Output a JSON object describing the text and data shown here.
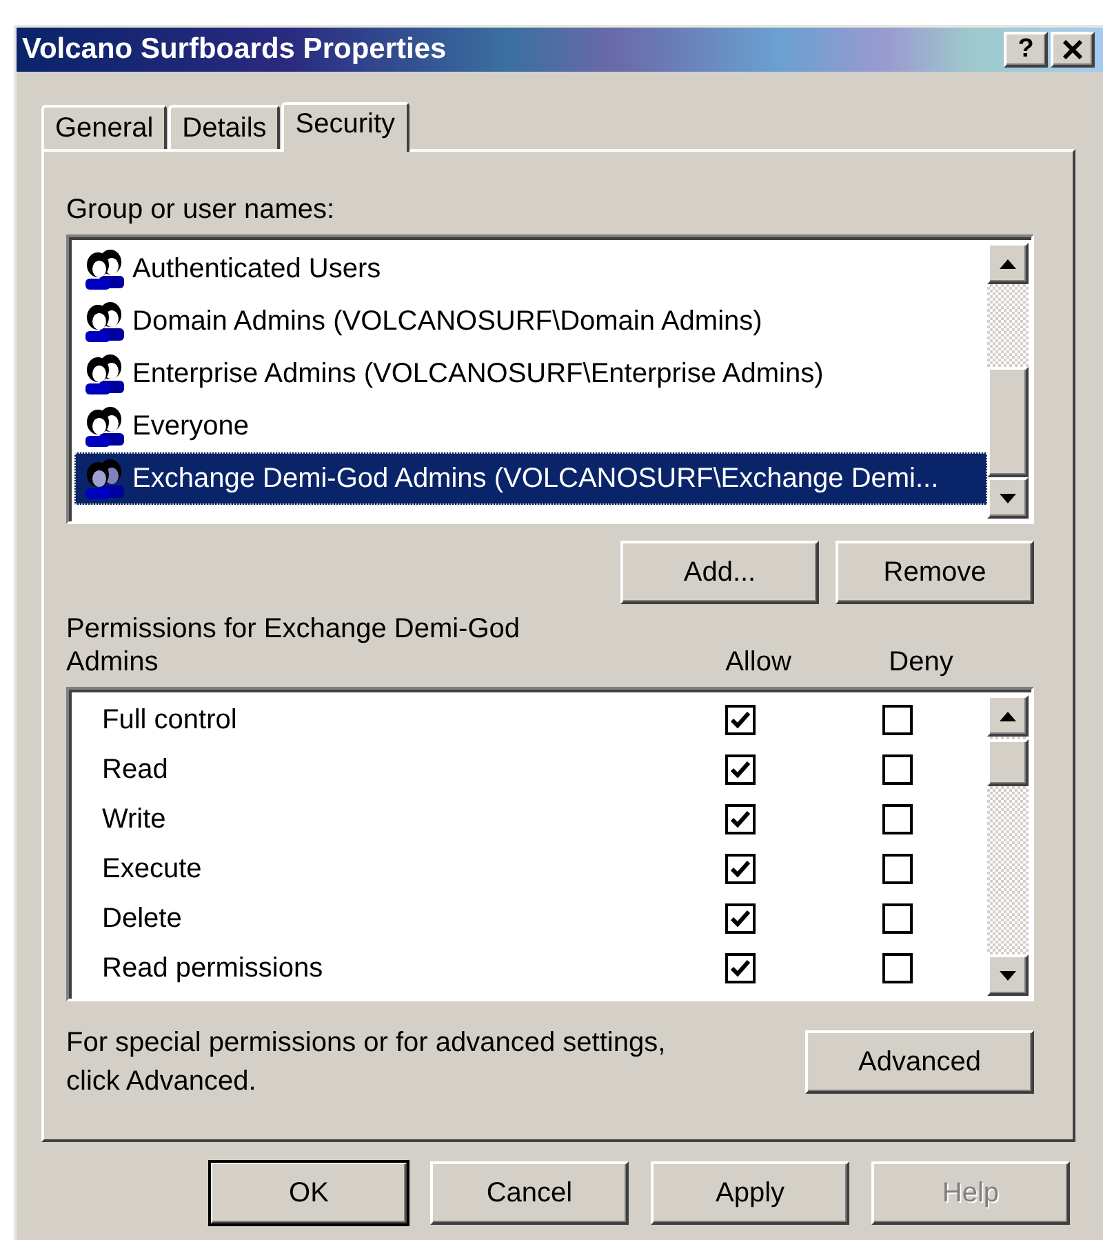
{
  "window": {
    "title": "Volcano Surfboards Properties",
    "help_button": "?"
  },
  "tabs": [
    {
      "label": "General",
      "selected": false
    },
    {
      "label": "Details",
      "selected": false
    },
    {
      "label": "Security",
      "selected": true
    }
  ],
  "groups": {
    "label": "Group or user names:",
    "items": [
      {
        "name": "Authenticated Users",
        "selected": false
      },
      {
        "name": "Domain Admins (VOLCANOSURF\\Domain Admins)",
        "selected": false
      },
      {
        "name": "Enterprise Admins (VOLCANOSURF\\Enterprise Admins)",
        "selected": false
      },
      {
        "name": "Everyone",
        "selected": false
      },
      {
        "name": "Exchange Demi-God Admins (VOLCANOSURF\\Exchange Demi...",
        "selected": true
      }
    ],
    "buttons": [
      "Add...",
      "Remove"
    ]
  },
  "permissions": {
    "label": "Permissions for Exchange Demi-God Admins",
    "columns": [
      "Allow",
      "Deny"
    ],
    "rows": [
      {
        "name": "Full control",
        "allow": true,
        "deny": false
      },
      {
        "name": "Read",
        "allow": true,
        "deny": false
      },
      {
        "name": "Write",
        "allow": true,
        "deny": false
      },
      {
        "name": "Execute",
        "allow": true,
        "deny": false
      },
      {
        "name": "Delete",
        "allow": true,
        "deny": false
      },
      {
        "name": "Read permissions",
        "allow": true,
        "deny": false
      }
    ]
  },
  "advanced": {
    "text": "For special permissions or for advanced settings, click Advanced.",
    "button": "Advanced"
  },
  "footer_buttons": [
    {
      "label": "OK",
      "kind": "default",
      "disabled": false
    },
    {
      "label": "Cancel",
      "kind": "normal",
      "disabled": false
    },
    {
      "label": "Apply",
      "kind": "normal",
      "disabled": false
    },
    {
      "label": "Help",
      "kind": "normal",
      "disabled": true
    }
  ]
}
